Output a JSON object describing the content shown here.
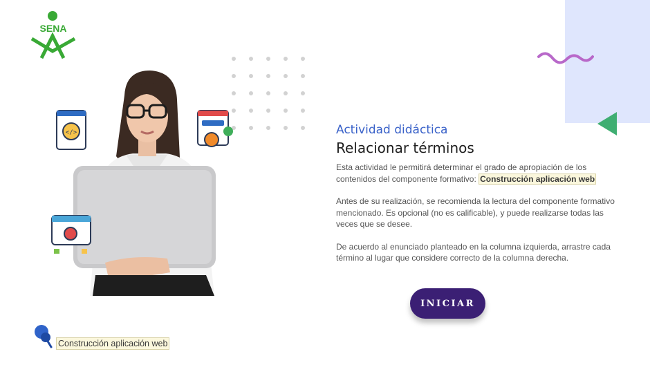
{
  "logo": {
    "text": "SENA",
    "color": "#39a935"
  },
  "hero": {
    "description_icon": "woman-with-laptop-illustration"
  },
  "content": {
    "activity_label": "Actividad didáctica",
    "activity_title": "Relacionar términos",
    "paragraph1_text": "Esta actividad le permitirá determinar el grado de apropiación de los contenidos del componente formativo: ",
    "paragraph1_highlight": "Construcción aplicación web",
    "paragraph2": "Antes de su realización, se recomienda la lectura del componente formativo mencionado.  Es opcional (no es calificable), y puede realizarse todas las veces que se desee.",
    "paragraph3": "De acuerdo al enunciado planteado en la columna izquierda, arrastre cada término al lugar que considere correcto de la columna derecha."
  },
  "button": {
    "label": "INICIAR"
  },
  "footer": {
    "label": "Construcción aplicación web"
  },
  "colors": {
    "accent_blue": "#3a62c9",
    "button_bg": "#3b1f74",
    "panel_bg": "#dfe6fd",
    "squiggle": "#b868c9",
    "triangle": "#3fae72",
    "highlight_bg": "#fbf7dc"
  }
}
